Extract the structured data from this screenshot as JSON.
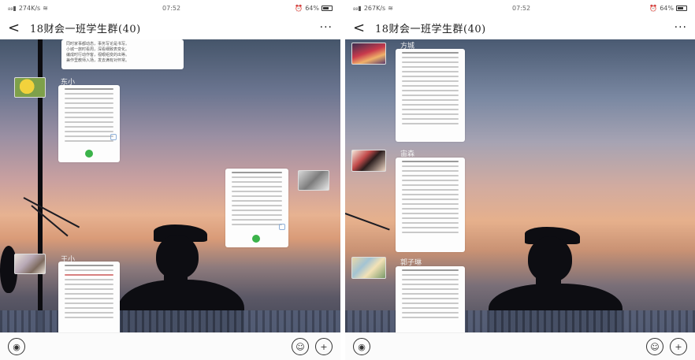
{
  "screens": [
    {
      "status": {
        "signal": "₈₈▮",
        "speed": "274K/s",
        "time": "07:52",
        "battery_pct": "64%"
      },
      "header": {
        "back_icon": "chevron-left-icon",
        "title": "18财会一班学生群(40)",
        "more_icon": "more-dots-icon"
      },
      "senders": {
        "a": "东小",
        "b": "王小",
        "c": ""
      },
      "snippet": "同时家事都动态，事务写论是书写。\n小城一旅时看周，深看细致表变化。\n编成时行动作客，视眼组变的出等。\n兼作里教师入场，发去满有对怀常。",
      "bottom": {
        "voice_icon": "voice-icon",
        "emoji_icon": "emoji-icon",
        "add_icon": "plus-icon"
      }
    },
    {
      "status": {
        "signal": "₈₈▮",
        "speed": "267K/s",
        "time": "07:52",
        "battery_pct": "64%"
      },
      "header": {
        "back_icon": "chevron-left-icon",
        "title": "18财会一班学生群(40)",
        "more_icon": "more-dots-icon"
      },
      "senders": {
        "a": "方城",
        "b": "宙森",
        "c": "郭子琳"
      },
      "bottom": {
        "voice_icon": "voice-icon",
        "emoji_icon": "emoji-icon",
        "add_icon": "plus-icon"
      }
    }
  ]
}
